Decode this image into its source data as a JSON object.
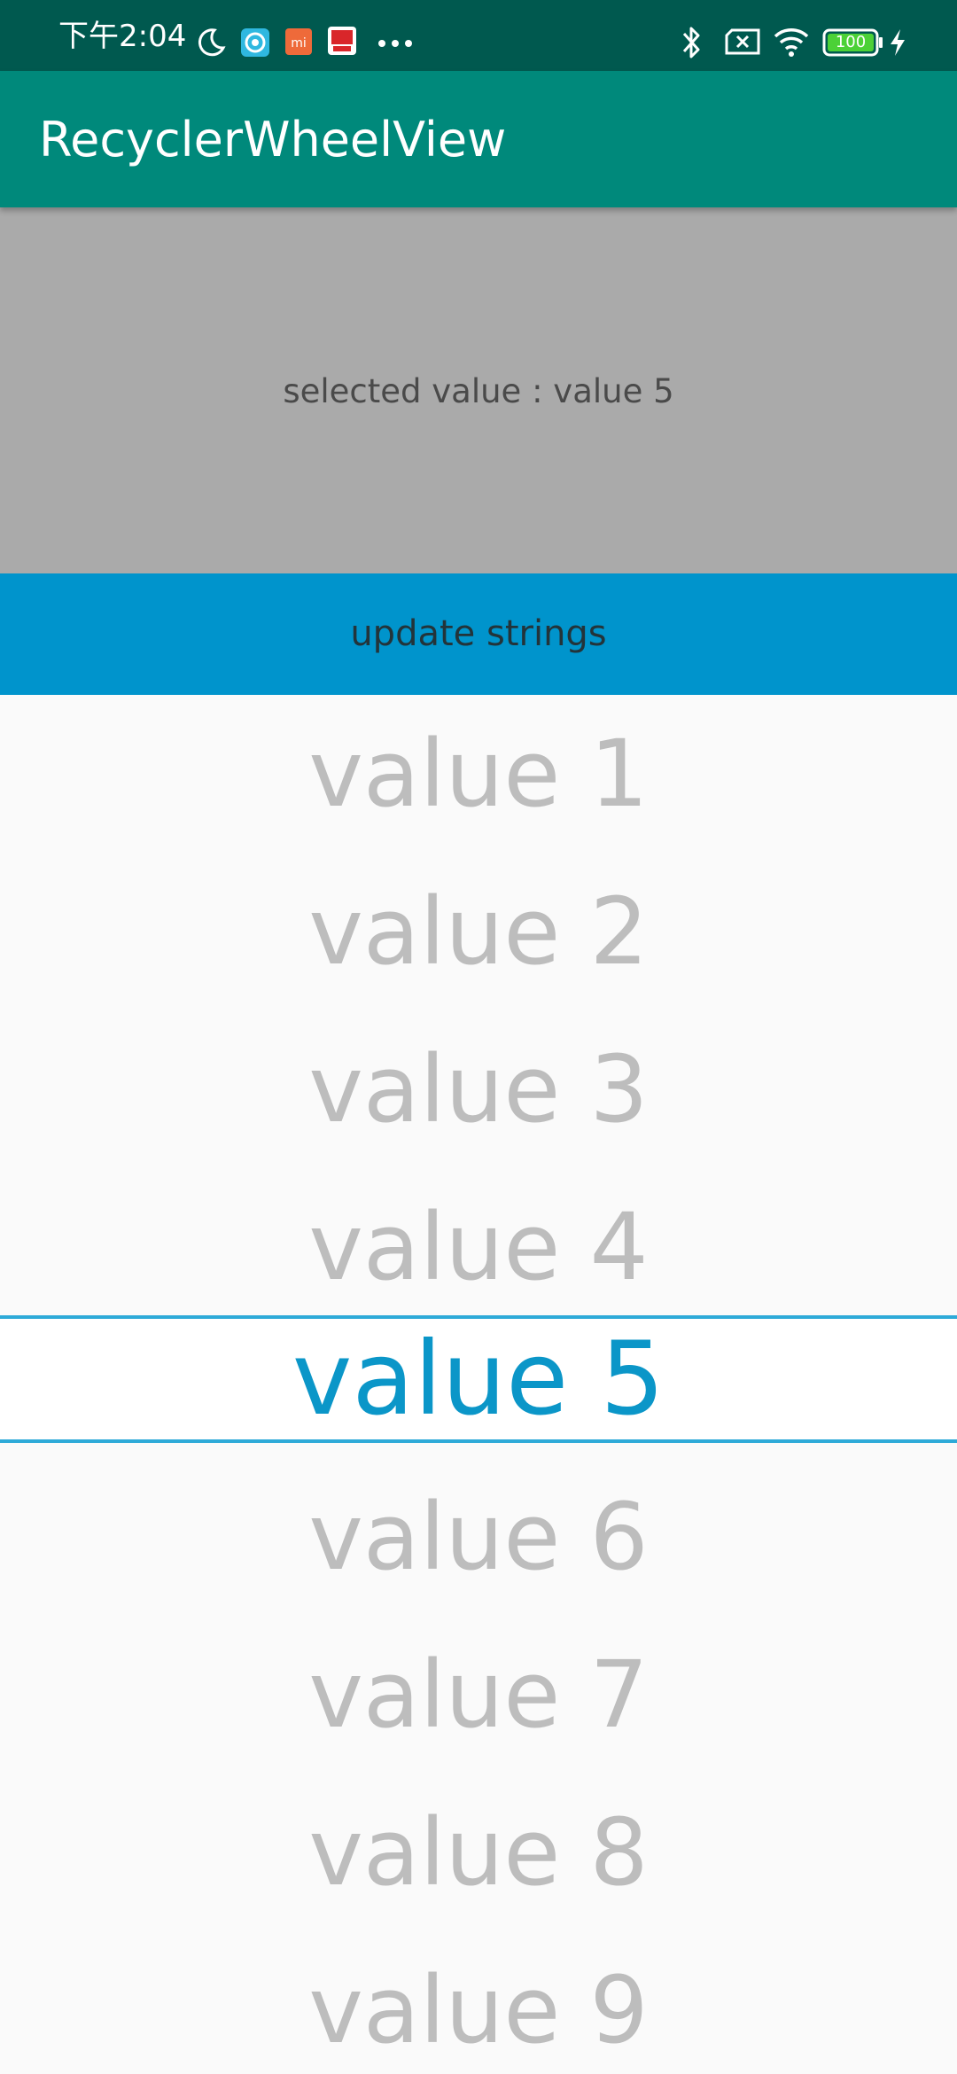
{
  "status_bar": {
    "time": "下午2:04",
    "battery_level": "100",
    "icons": [
      "moon-icon",
      "app-notification-icon",
      "mi-icon",
      "app-notification-icon",
      "more-dots-icon",
      "bluetooth-icon",
      "sim-off-icon",
      "wifi-icon",
      "battery-icon",
      "charging-icon"
    ]
  },
  "app_bar": {
    "title": "RecyclerWheelView"
  },
  "selected_panel": {
    "text": "selected value : value 5"
  },
  "update_button": {
    "label": "update strings"
  },
  "wheel": {
    "items": [
      "value 1",
      "value 2",
      "value 3",
      "value 4",
      "value 5",
      "value 6",
      "value 7",
      "value 8",
      "value 9"
    ],
    "selected_index": 4
  },
  "colors": {
    "status_bar": "#00594f",
    "app_bar": "#00897b",
    "panel": "#aaaaaa",
    "button": "#0094cc",
    "accent": "#0b96c8",
    "item_text": "#bdbdbd"
  }
}
